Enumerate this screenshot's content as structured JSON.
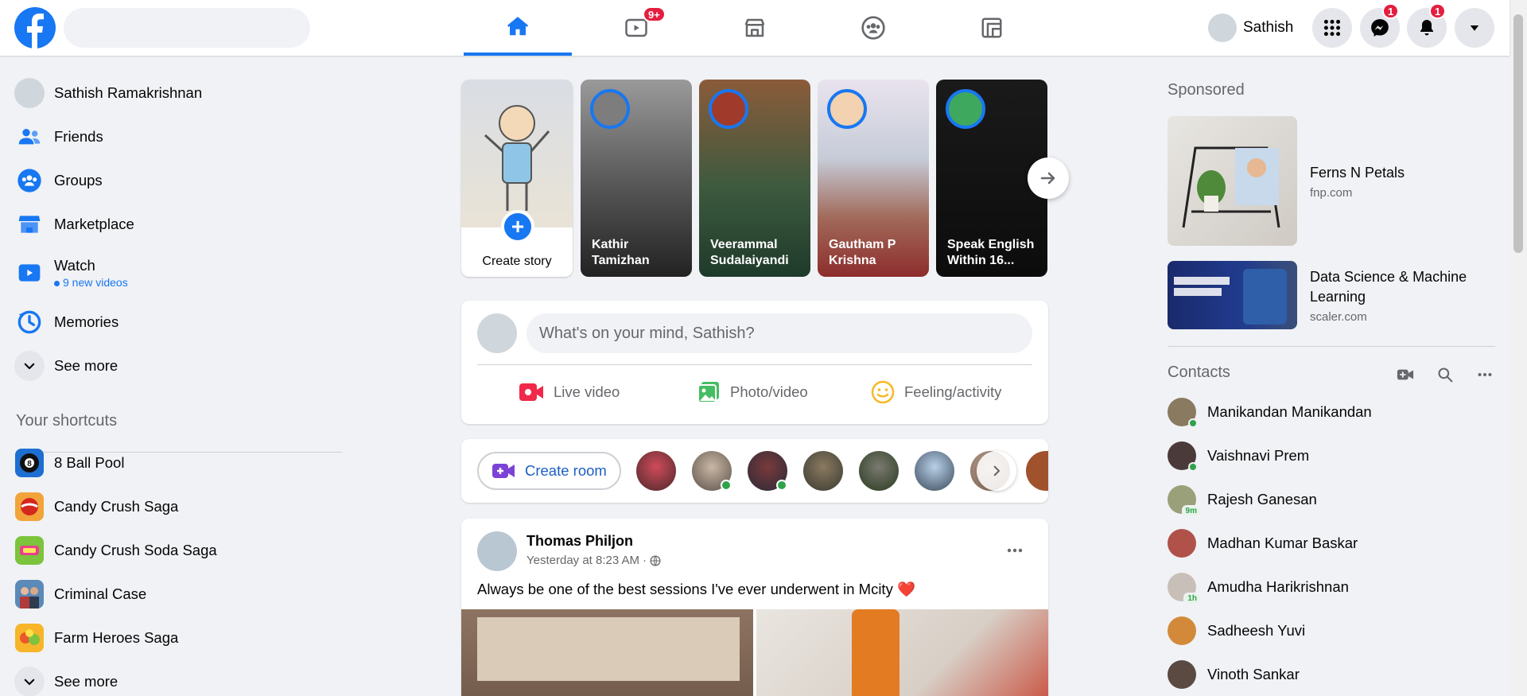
{
  "colors": {
    "brand": "#1877f2",
    "notification": "#e41e3f",
    "online": "#31a24c"
  },
  "header": {
    "search_placeholder": "",
    "tabs": [
      {
        "name": "home",
        "icon": "home-icon",
        "active": true
      },
      {
        "name": "watch",
        "icon": "watch-icon",
        "badge": "9+"
      },
      {
        "name": "marketplace",
        "icon": "marketplace-icon"
      },
      {
        "name": "groups",
        "icon": "groups-icon"
      },
      {
        "name": "gaming",
        "icon": "gaming-icon"
      }
    ],
    "profile_name": "Sathish",
    "messenger_badge": "1",
    "notifications_badge": "1"
  },
  "sidebar": {
    "items": [
      {
        "label": "Sathish Ramakrishnan",
        "icon": "profile-avatar"
      },
      {
        "label": "Friends",
        "icon": "friends-icon"
      },
      {
        "label": "Groups",
        "icon": "groups-icon"
      },
      {
        "label": "Marketplace",
        "icon": "marketplace-icon"
      },
      {
        "label": "Watch",
        "icon": "watch-icon",
        "sub": "9 new videos"
      },
      {
        "label": "Memories",
        "icon": "memories-icon"
      },
      {
        "label": "See more",
        "icon": "chevron-down-icon"
      }
    ],
    "shortcuts_title": "Your shortcuts",
    "shortcuts": [
      {
        "label": "8 Ball Pool"
      },
      {
        "label": "Candy Crush Saga"
      },
      {
        "label": "Candy Crush Soda Saga"
      },
      {
        "label": "Criminal Case"
      },
      {
        "label": "Farm Heroes Saga"
      },
      {
        "label": "See more"
      }
    ]
  },
  "stories": {
    "create_label": "Create story",
    "items": [
      {
        "name": "Kathir Tamizhan"
      },
      {
        "name": "Veerammal Sudalaiyandi"
      },
      {
        "name": "Gautham P Krishna"
      },
      {
        "name": "Speak English Within 16..."
      }
    ]
  },
  "composer": {
    "placeholder": "What's on your mind, Sathish?",
    "actions": [
      {
        "label": "Live video",
        "icon": "live-video-icon"
      },
      {
        "label": "Photo/video",
        "icon": "photo-video-icon"
      },
      {
        "label": "Feeling/activity",
        "icon": "feeling-icon"
      }
    ]
  },
  "rooms": {
    "create_label": "Create room"
  },
  "post": {
    "author": "Thomas Philjon",
    "time": "Yesterday at 8:23 AM",
    "separator": "·",
    "text": "Always be one of the best sessions I've ever underwent in Mcity ❤️"
  },
  "right": {
    "sponsored_title": "Sponsored",
    "ads": [
      {
        "title": "Ferns N Petals",
        "domain": "fnp.com"
      },
      {
        "title": "Data Science & Machine Learning",
        "domain": "scaler.com"
      }
    ],
    "contacts_title": "Contacts",
    "contacts": [
      {
        "name": "Manikandan Manikandan",
        "online": true
      },
      {
        "name": "Vaishnavi Prem",
        "online": true
      },
      {
        "name": "Rajesh Ganesan",
        "status": "9m"
      },
      {
        "name": "Madhan Kumar Baskar"
      },
      {
        "name": "Amudha Harikrishnan",
        "status": "1h"
      },
      {
        "name": "Sadheesh Yuvi"
      },
      {
        "name": "Vinoth Sankar"
      }
    ]
  }
}
